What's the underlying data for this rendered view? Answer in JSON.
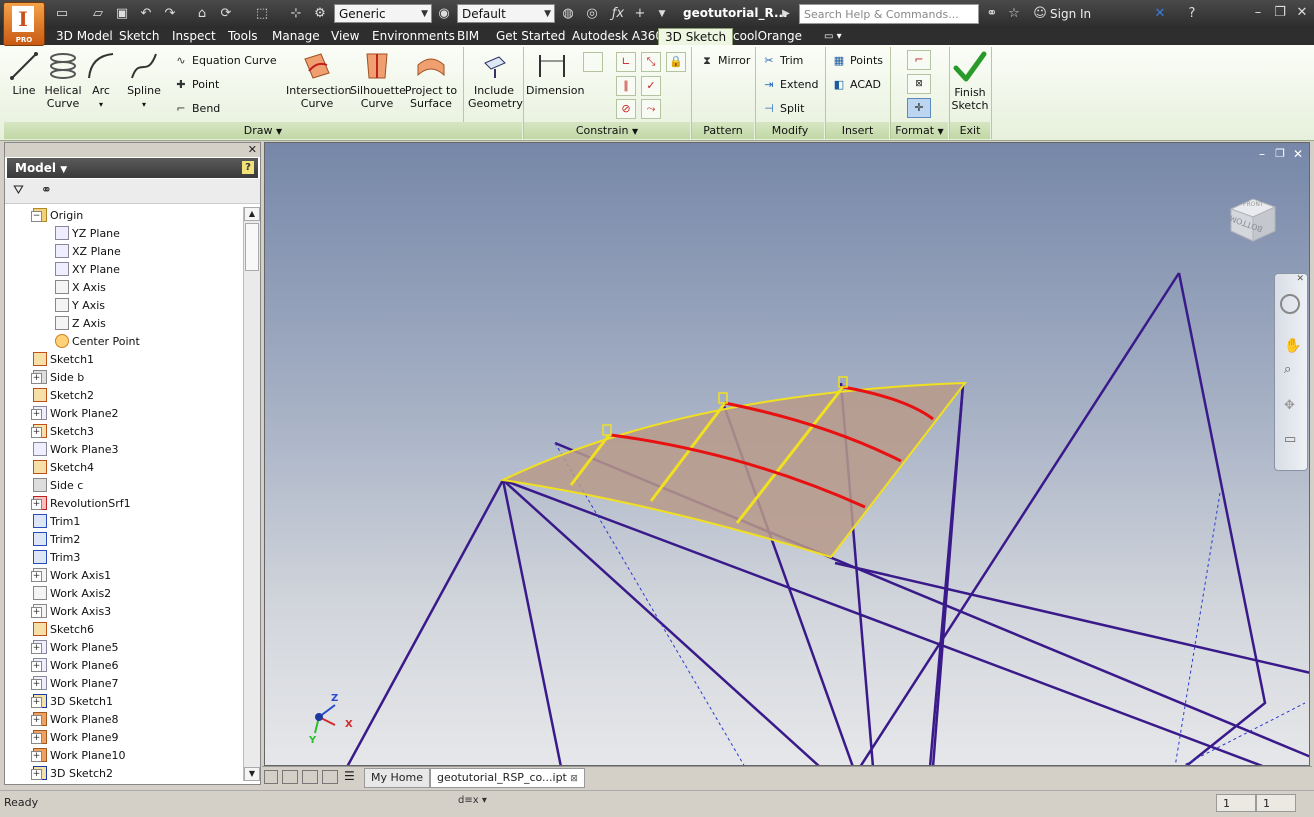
{
  "app": {
    "badge": "PRO",
    "logo_letter": "I"
  },
  "quick_access": {
    "material_combo": "Generic",
    "appearance_combo": "Default",
    "document_title": "geotutorial_R...",
    "search_placeholder": "Search Help & Commands...",
    "sign_in": "Sign In"
  },
  "tabs": [
    "3D Model",
    "Sketch",
    "Inspect",
    "Tools",
    "Manage",
    "View",
    "Environments",
    "BIM",
    "Get Started",
    "Autodesk A360",
    "3D Sketch",
    "coolOrange"
  ],
  "active_tab": "3D Sketch",
  "ribbon": {
    "draw": {
      "label": "Draw",
      "line": "Line",
      "helical_curve": "Helical\nCurve",
      "arc": "Arc",
      "spline": "Spline",
      "equation_curve": "Equation Curve",
      "point": "Point",
      "bend": "Bend",
      "intersection_curve": "Intersection\nCurve",
      "silhouette_curve": "Silhouette\nCurve",
      "project_to_surface": "Project to\nSurface",
      "include_geometry": "Include\nGeometry"
    },
    "constrain": {
      "label": "Constrain",
      "dimension": "Dimension"
    },
    "pattern": {
      "label": "Pattern",
      "mirror": "Mirror"
    },
    "modify": {
      "label": "Modify",
      "trim": "Trim",
      "extend": "Extend",
      "split": "Split"
    },
    "insert": {
      "label": "Insert",
      "points": "Points",
      "acad": "ACAD"
    },
    "format": {
      "label": "Format"
    },
    "exit": {
      "label": "Exit",
      "finish_sketch": "Finish\nSketch"
    }
  },
  "browser": {
    "title": "Model",
    "items": [
      {
        "label": "Origin",
        "indent": 1,
        "expander": "−",
        "icon": "folder-icon"
      },
      {
        "label": "YZ Plane",
        "indent": 2,
        "icon": "plane-icon"
      },
      {
        "label": "XZ Plane",
        "indent": 2,
        "icon": "plane-icon"
      },
      {
        "label": "XY Plane",
        "indent": 2,
        "icon": "plane-icon"
      },
      {
        "label": "X Axis",
        "indent": 2,
        "icon": "axis-icon"
      },
      {
        "label": "Y Axis",
        "indent": 2,
        "icon": "axis-icon"
      },
      {
        "label": "Z Axis",
        "indent": 2,
        "icon": "axis-icon"
      },
      {
        "label": "Center Point",
        "indent": 2,
        "icon": "point-icon"
      },
      {
        "label": "Sketch1",
        "indent": 1,
        "icon": "sketch-icon"
      },
      {
        "label": "Side b",
        "indent": 1,
        "expander": "+",
        "icon": "surface-icon"
      },
      {
        "label": "Sketch2",
        "indent": 1,
        "icon": "sketch-icon"
      },
      {
        "label": "Work Plane2",
        "indent": 1,
        "expander": "+",
        "icon": "plane-icon"
      },
      {
        "label": "Sketch3",
        "indent": 1,
        "expander": "+",
        "icon": "sketch-icon"
      },
      {
        "label": "Work Plane3",
        "indent": 1,
        "icon": "plane-icon"
      },
      {
        "label": "Sketch4",
        "indent": 1,
        "icon": "sketch-icon"
      },
      {
        "label": "Side c",
        "indent": 1,
        "icon": "surface-icon"
      },
      {
        "label": "RevolutionSrf1",
        "indent": 1,
        "expander": "+",
        "icon": "revolve-icon"
      },
      {
        "label": "Trim1",
        "indent": 1,
        "icon": "trim-icon"
      },
      {
        "label": "Trim2",
        "indent": 1,
        "icon": "trim-icon"
      },
      {
        "label": "Trim3",
        "indent": 1,
        "icon": "trim-icon"
      },
      {
        "label": "Work Axis1",
        "indent": 1,
        "expander": "+",
        "icon": "axis-icon"
      },
      {
        "label": "Work Axis2",
        "indent": 1,
        "icon": "axis-icon"
      },
      {
        "label": "Work Axis3",
        "indent": 1,
        "expander": "+",
        "icon": "axis-icon"
      },
      {
        "label": "Sketch6",
        "indent": 1,
        "icon": "sketch-icon"
      },
      {
        "label": "Work Plane5",
        "indent": 1,
        "expander": "+",
        "icon": "plane-icon"
      },
      {
        "label": "Work Plane6",
        "indent": 1,
        "expander": "+",
        "icon": "plane-icon"
      },
      {
        "label": "Work Plane7",
        "indent": 1,
        "expander": "+",
        "icon": "plane-icon"
      },
      {
        "label": "3D Sketch1",
        "indent": 1,
        "expander": "+",
        "icon": "sketch3d-icon"
      },
      {
        "label": "Work Plane8",
        "indent": 1,
        "expander": "+",
        "icon": "plane-orange-icon"
      },
      {
        "label": "Work Plane9",
        "indent": 1,
        "expander": "+",
        "icon": "plane-orange-icon"
      },
      {
        "label": "Work Plane10",
        "indent": 1,
        "expander": "+",
        "icon": "plane-orange-icon"
      },
      {
        "label": "3D Sketch2",
        "indent": 1,
        "expander": "+",
        "icon": "sketch3d-icon"
      }
    ]
  },
  "viewcube": {
    "top_face": "FRONT",
    "side_face": "BOTTOM"
  },
  "triad": {
    "x": "X",
    "y": "Y",
    "z": "Z"
  },
  "document_tabs": {
    "home": "My Home",
    "file": "geotutorial_RSP_co...ipt"
  },
  "status": {
    "text": "Ready",
    "count1": "1",
    "count2": "1"
  },
  "colors": {
    "wire": "#3a1a8a",
    "surface_edge": "#f0e020",
    "iso_curve": "#e81010",
    "surface_fill": "#b89a8a"
  }
}
